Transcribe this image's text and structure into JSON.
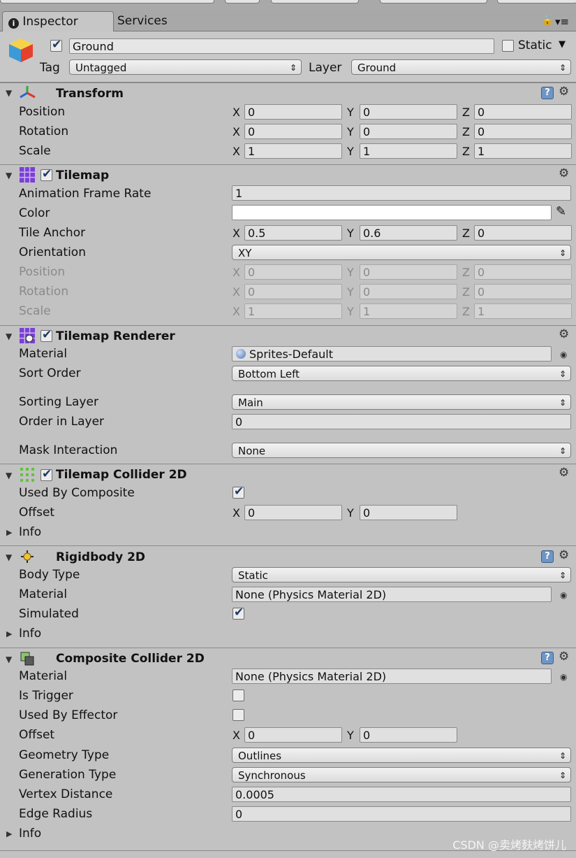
{
  "tabs": {
    "inspector": "Inspector",
    "services": "Services"
  },
  "icons": {
    "lock": "lock-icon",
    "menu": "menu-icon"
  },
  "object": {
    "name": "Ground",
    "static_label": "Static",
    "tag_label": "Tag",
    "tag_value": "Untagged",
    "layer_label": "Layer",
    "layer_value": "Ground",
    "active": true,
    "static": false
  },
  "axes": {
    "x": "X",
    "y": "Y",
    "z": "Z"
  },
  "transform": {
    "title": "Transform",
    "position_label": "Position",
    "position": [
      "0",
      "0",
      "0"
    ],
    "rotation_label": "Rotation",
    "rotation": [
      "0",
      "0",
      "0"
    ],
    "scale_label": "Scale",
    "scale": [
      "1",
      "1",
      "1"
    ]
  },
  "tilemap": {
    "title": "Tilemap",
    "enabled": true,
    "frame_rate_label": "Animation Frame Rate",
    "frame_rate": "1",
    "color_label": "Color",
    "color": "#ffffff",
    "anchor_label": "Tile Anchor",
    "anchor": [
      "0.5",
      "0.6",
      "0"
    ],
    "orientation_label": "Orientation",
    "orientation": "XY",
    "position_label": "Position",
    "position": [
      "0",
      "0",
      "0"
    ],
    "rotation_label": "Rotation",
    "rotation": [
      "0",
      "0",
      "0"
    ],
    "scale_label": "Scale",
    "scale": [
      "1",
      "1",
      "1"
    ]
  },
  "renderer": {
    "title": "Tilemap Renderer",
    "enabled": true,
    "material_label": "Material",
    "material": "Sprites-Default",
    "sort_label": "Sort Order",
    "sort": "Bottom Left",
    "sorting_layer_label": "Sorting Layer",
    "sorting_layer": "Main",
    "order_label": "Order in Layer",
    "order": "0",
    "mask_label": "Mask Interaction",
    "mask": "None"
  },
  "tcollider": {
    "title": "Tilemap Collider 2D",
    "enabled": true,
    "used_by_composite_label": "Used By Composite",
    "used_by_composite": true,
    "offset_label": "Offset",
    "offset": [
      "0",
      "0"
    ],
    "info_label": "Info"
  },
  "rigidbody": {
    "title": "Rigidbody 2D",
    "body_type_label": "Body Type",
    "body_type": "Static",
    "material_label": "Material",
    "material": "None (Physics Material 2D)",
    "simulated_label": "Simulated",
    "simulated": true,
    "info_label": "Info"
  },
  "composite": {
    "title": "Composite Collider 2D",
    "material_label": "Material",
    "material": "None (Physics Material 2D)",
    "trigger_label": "Is Trigger",
    "trigger": false,
    "effector_label": "Used By Effector",
    "effector": false,
    "offset_label": "Offset",
    "offset": [
      "0",
      "0"
    ],
    "geometry_label": "Geometry Type",
    "geometry": "Outlines",
    "generation_label": "Generation Type",
    "generation": "Synchronous",
    "vertex_label": "Vertex Distance",
    "vertex": "0.0005",
    "edge_label": "Edge Radius",
    "edge": "0",
    "info_label": "Info"
  },
  "watermark": "CSDN @卖烤麸烤饼儿"
}
